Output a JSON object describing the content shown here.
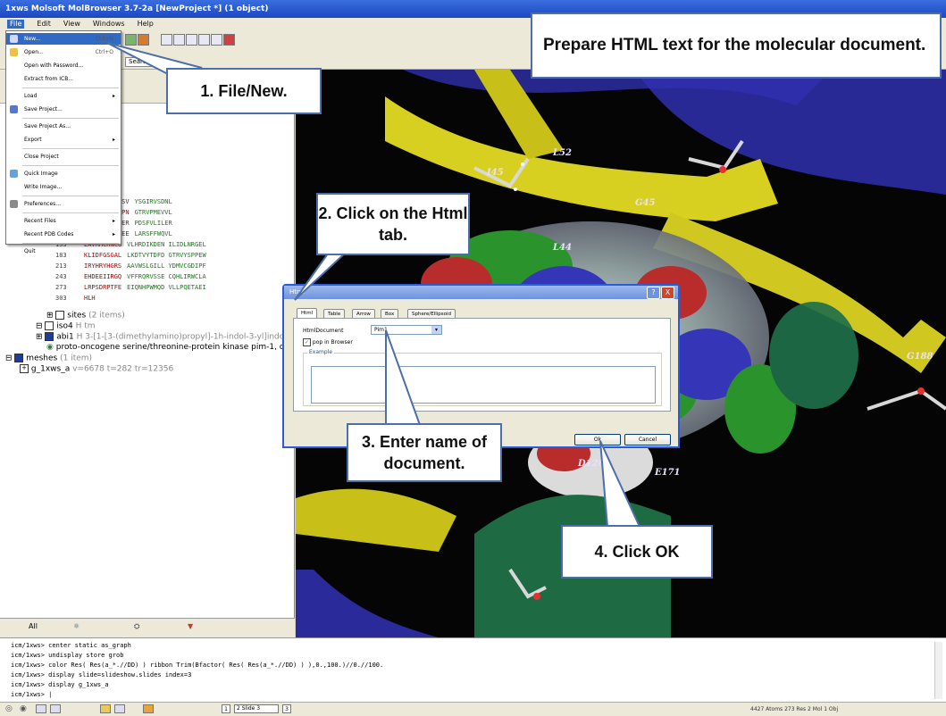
{
  "window": {
    "title": "1xws Molsoft MolBrowser 3.7-2a [NewProject *] (1 object)"
  },
  "menubar": [
    "File",
    "Edit",
    "View",
    "Windows",
    "Help"
  ],
  "toolbar": {
    "search_tab_label": "Search"
  },
  "file_menu": {
    "items": [
      {
        "label": "New...",
        "shortcut": "Ctrl+N",
        "highlighted": true
      },
      {
        "label": "Open...",
        "shortcut": "Ctrl+O"
      },
      {
        "label": "Open with Password..."
      },
      {
        "label": "Extract from ICB..."
      },
      {
        "label": "Load",
        "submenu": true
      },
      {
        "label": "Save Project..."
      },
      {
        "label": "Save Project As..."
      },
      {
        "label": "Export",
        "submenu": true
      },
      {
        "label": "Close Project"
      },
      {
        "label": "Quick Image"
      },
      {
        "label": "Write Image..."
      },
      {
        "label": "Preferences..."
      },
      {
        "label": "Recent Files",
        "submenu": true
      },
      {
        "label": "Recent PDB Codes",
        "submenu": true
      },
      {
        "label": "Quit"
      }
    ]
  },
  "sequence": {
    "rows": [
      {
        "num": "",
        "a": "P  LLGSGGFGSV",
        "b": "YSGIRVSDNL"
      },
      {
        "num": "",
        "a": "D  RISDWGELPN",
        "b": "GTRVPMEVVL"
      },
      {
        "num": "",
        "a": "G  VIRLLDWFER",
        "b": "PDSFVLILER"
      },
      {
        "num": "",
        "a": "F  ITERGALQEE",
        "b": "LARSFFWQVL"
      },
      {
        "num": "153",
        "a": "EAVRHCHNCG",
        "b": "VLHRDIKDEN ILIDLNRGEL"
      },
      {
        "num": "183",
        "a": "KLIDFGSGAL",
        "b": "LKDTVYTDFD GTRVYSPPEW"
      },
      {
        "num": "213",
        "a": "IRYHRYHGRS",
        "b": "AAVWSLGILL YDMVCGDIPF"
      },
      {
        "num": "243",
        "a": "EHDEEIIRGQ",
        "b": "VFFRQRVSSE CQHLIRWCLA"
      },
      {
        "num": "273",
        "a": "LRPSDRPTFE",
        "b": "EIQNHPWMQD VLLPQETAEI"
      },
      {
        "num": "303",
        "a": "HLH",
        "b": ""
      }
    ]
  },
  "tree": {
    "sites": {
      "label": "sites",
      "count": "(2 items)"
    },
    "iso4": {
      "label": "iso4",
      "info": "H  tm"
    },
    "abi1": {
      "label": "abi1",
      "info": "H  3-[1-[3-(dimethylamino)propyl]-1h-indol-3-yl]indol"
    },
    "protein": {
      "label": "proto-oncogene serine/threonine-protein kinase pim-1, chai"
    },
    "meshes": {
      "label": "meshes",
      "count": "(1 item)"
    },
    "mesh_item": {
      "label": "g_1xws_a",
      "info": "v=6678 t=282 tr=12356"
    }
  },
  "left_tabs": [
    "All"
  ],
  "callouts": {
    "heading": "Prepare HTML text for the molecular document.",
    "step1": "1. File/New.",
    "step2": "2. Click on the Html tab.",
    "step3": "3. Enter name of document.",
    "step4": "4. Click OK"
  },
  "residue_labels": [
    {
      "text": "L52"
    },
    {
      "text": "I45"
    },
    {
      "text": "G45"
    },
    {
      "text": "L44"
    },
    {
      "text": "G188"
    },
    {
      "text": "D128"
    },
    {
      "text": "E171"
    }
  ],
  "dialog": {
    "title": "Html",
    "tabs": [
      "Html",
      "Table",
      "Arrow",
      "Box",
      "Sphere/Ellipsoid"
    ],
    "selected_tab": "Html",
    "field_label": "HtmlDocument",
    "field_value": "Pim1",
    "checkbox_label": "pop in Browser",
    "checkbox_checked": true,
    "group_label": "Example",
    "ok_label": "Ok",
    "cancel_label": "Cancel",
    "help_label": "?",
    "close_label": "X"
  },
  "console": {
    "lines": [
      "icm/1xws> center static as_graph",
      "icm/1xws> undisplay store grob",
      "icm/1xws> color Res( Res(a_*.//DD) ) ribbon Trim(Bfactor( Res( Res(a_*.//DD) ) ),0.,100.)//0.//100.",
      "icm/1xws> display slide=slideshow.slides index=3",
      "icm/1xws> display g_1xws_a",
      "icm/1xws> |"
    ]
  },
  "statusbar": {
    "slide_label": "2 Slide 3",
    "page": "1",
    "page2": "3",
    "right_text": "4427 Atoms 273 Res 2 Mol 1 Obj"
  }
}
